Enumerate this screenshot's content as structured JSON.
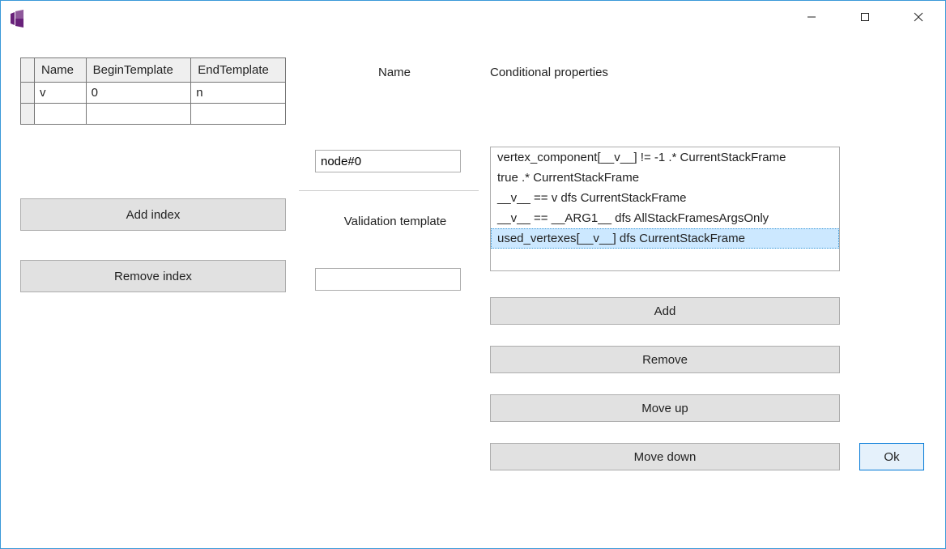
{
  "titlebar": {
    "title": ""
  },
  "table": {
    "headers": {
      "name": "Name",
      "begin": "BeginTemplate",
      "end": "EndTemplate"
    },
    "rows": [
      {
        "name": "v",
        "begin": "0",
        "end": "n"
      },
      {
        "name": "",
        "begin": "",
        "end": ""
      }
    ]
  },
  "buttons": {
    "add_index": "Add index",
    "remove_index": "Remove index",
    "add": "Add",
    "remove": "Remove",
    "move_up": "Move up",
    "move_down": "Move down",
    "ok": "Ok"
  },
  "labels": {
    "name": "Name",
    "validation": "Validation template",
    "conditional": "Conditional properties"
  },
  "fields": {
    "name_value": "node#0",
    "validation_value": ""
  },
  "conditional": {
    "items": [
      "vertex_component[__v__] != -1 .* CurrentStackFrame",
      "true .* CurrentStackFrame",
      "__v__ == v dfs CurrentStackFrame",
      "__v__ == __ARG1__ dfs AllStackFramesArgsOnly",
      "used_vertexes[__v__] dfs CurrentStackFrame"
    ],
    "selected_index": 4
  }
}
